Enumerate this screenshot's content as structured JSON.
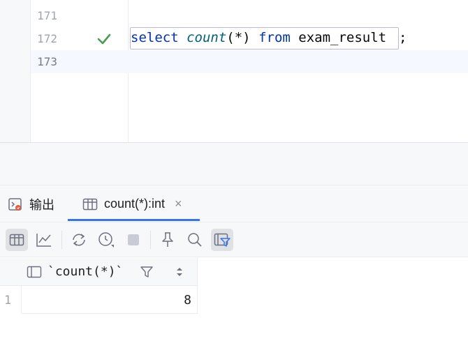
{
  "editor": {
    "lines": [
      {
        "number": "171",
        "code": ""
      },
      {
        "number": "172",
        "code_parts": {
          "kw1": "select",
          "fn": "count",
          "args": "(*)",
          "kw2": "from",
          "table": "exam_result",
          "semi": ";"
        }
      },
      {
        "number": "173",
        "code": ""
      }
    ],
    "status_icon": "check-icon"
  },
  "tabs": [
    {
      "label": "输出",
      "icon": "output-console-icon"
    },
    {
      "label": "count(*):int",
      "icon": "table-grid-icon",
      "close": "×",
      "active": true
    }
  ],
  "toolbar": {
    "buttons": [
      {
        "name": "table-view-icon",
        "selected": true
      },
      {
        "name": "chart-view-icon"
      },
      {
        "name": "refresh-icon"
      },
      {
        "name": "history-icon"
      },
      {
        "name": "stop-icon"
      },
      {
        "name": "pin-icon"
      },
      {
        "name": "search-icon"
      },
      {
        "name": "filter-panel-icon",
        "selected": true
      }
    ]
  },
  "grid": {
    "column": "`count(*)`",
    "rows": [
      {
        "index": "1",
        "value": "8"
      }
    ]
  },
  "colors": {
    "keyword": "#0033b3",
    "function": "#00627a",
    "check": "#499c54",
    "accent": "#3574f0"
  }
}
